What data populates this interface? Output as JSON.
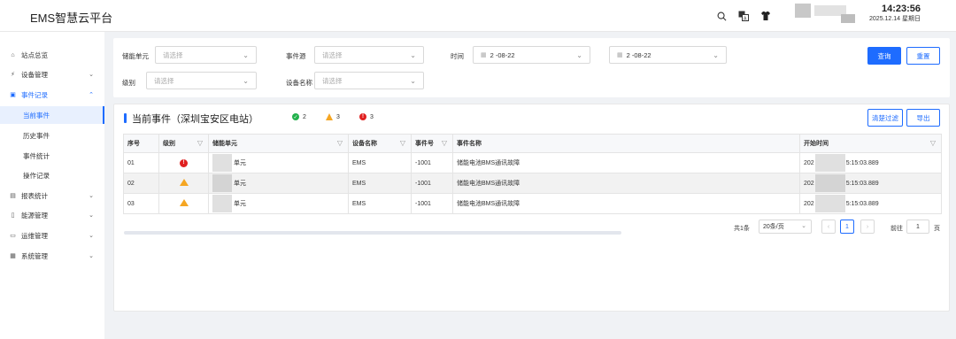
{
  "app": {
    "title": "EMS智慧云平台"
  },
  "header": {
    "time": "14:23:56",
    "date": "2025.12.14 星期日",
    "icons": [
      "search-icon",
      "translate-icon",
      "shirt-icon"
    ]
  },
  "sidebar": {
    "items": [
      {
        "icon": "home-icon",
        "label": "站点总览",
        "has_children": false
      },
      {
        "icon": "bolt-icon",
        "label": "设备管理",
        "has_children": true
      },
      {
        "icon": "record-icon",
        "label": "事件记录",
        "has_children": true,
        "open": true
      },
      {
        "icon": "report-icon",
        "label": "报表统计",
        "has_children": true
      },
      {
        "icon": "energy-icon",
        "label": "能源管理",
        "has_children": true
      },
      {
        "icon": "monitor-icon",
        "label": "运维管理",
        "has_children": true
      },
      {
        "icon": "system-icon",
        "label": "系统管理",
        "has_children": true
      }
    ],
    "sub_items": [
      "当前事件",
      "历史事件",
      "事件统计",
      "操作记录"
    ],
    "active_sub": "当前事件"
  },
  "filters": {
    "storage_unit_label": "储能单元",
    "storage_unit_placeholder": "请选择",
    "event_source_label": "事件源",
    "event_source_placeholder": "请选择",
    "time_label": "时间",
    "time_start": "2    -08-22",
    "time_end": "2    -08-22",
    "level_label": "级别",
    "level_placeholder": "请选择",
    "device_name_label": "设备名称",
    "device_name_placeholder": "请选择",
    "query_button": "查询",
    "reset_button": "重置"
  },
  "panel": {
    "title": "当前事件（深圳宝安区电站）",
    "counts": {
      "normal": "2",
      "warning": "3",
      "error": "3"
    },
    "clear_filter_button": "清楚过滤",
    "export_button": "导出"
  },
  "table": {
    "columns": [
      "序号",
      "级别",
      "储能单元",
      "设备名称",
      "事件号",
      "事件名称",
      "开始时间"
    ],
    "rows": [
      {
        "seq": "01",
        "level": "error",
        "unit": "单元",
        "device": "EMS",
        "event_no": "-1001",
        "event_name": "储能电池BMS通讯故障",
        "start_prefix": "202",
        "start_suffix": "5:15:03.889"
      },
      {
        "seq": "02",
        "level": "warning",
        "unit": "单元",
        "device": "EMS",
        "event_no": "-1001",
        "event_name": "储能电池BMS通讯故障",
        "start_prefix": "202",
        "start_suffix": "5:15:03.889"
      },
      {
        "seq": "03",
        "level": "warning",
        "unit": "单元",
        "device": "EMS",
        "event_no": "-1001",
        "event_name": "储能电池BMS通讯故障",
        "start_prefix": "202",
        "start_suffix": "5:15:03.889"
      }
    ]
  },
  "pagination": {
    "total": "共1条",
    "page_size": "20条/页",
    "current_page": "1",
    "goto_label": "前往",
    "goto_value": "1",
    "page_unit": "页"
  },
  "colors": {
    "accent": "#1e6cff",
    "error": "#e02020",
    "warning": "#f5a623",
    "success": "#22b14c"
  }
}
